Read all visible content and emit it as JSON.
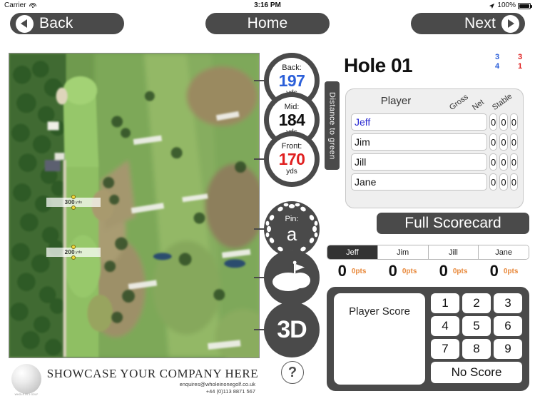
{
  "status_bar": {
    "carrier": "Carrier",
    "wifi_icon": "wifi-icon",
    "time": "3:16 PM",
    "location_icon": "location-arrow-icon",
    "battery_percent": "100%",
    "battery_icon": "battery-full-icon"
  },
  "nav": {
    "back_label": "Back",
    "back_icon": "chevron-left-circle-icon",
    "home_label": "Home",
    "next_label": "Next",
    "next_icon": "chevron-right-circle-icon"
  },
  "map": {
    "name": "aerial-hole-view",
    "markers": [
      {
        "label": "300",
        "unit": "yds"
      },
      {
        "label": "200",
        "unit": "yds"
      }
    ]
  },
  "distance": {
    "panel_label": "Distance to green",
    "readings": [
      {
        "name": "back",
        "label": "Back:",
        "value": "197",
        "unit": "yds",
        "color": "#2b5fd9"
      },
      {
        "name": "mid",
        "label": "Mid:",
        "value": "184",
        "unit": "yds",
        "color": "#111111"
      },
      {
        "name": "front",
        "label": "Front:",
        "value": "170",
        "unit": "yds",
        "color": "#e02020"
      }
    ]
  },
  "tools": {
    "pin_label": "Pin:",
    "pin_value": "a",
    "green_icon": "green-flag-icon",
    "three_d_label": "3D",
    "help_label": "?"
  },
  "advert": {
    "logo_icon": "golf-ball-icon",
    "logo_caption": "WHOLE IN 1 GOLF",
    "headline": "SHOWCASE YOUR COMPANY HERE",
    "email": "enquires@wholeinonegolf.co.uk",
    "phone": "+44 (0)113 8871 567"
  },
  "hole": {
    "title": "Hole 01",
    "stats": [
      {
        "value": "3",
        "color": "#2b5fd9"
      },
      {
        "value": "3",
        "color": "#e02020"
      },
      {
        "value": "4",
        "color": "#2b5fd9"
      },
      {
        "value": "1",
        "color": "#e02020"
      }
    ]
  },
  "scorecard": {
    "player_header": "Player",
    "columns": [
      "Gross",
      "Net",
      "Stable"
    ],
    "rows": [
      {
        "player": "Jeff",
        "gross": "0",
        "net": "0",
        "stable": "0",
        "selected": true
      },
      {
        "player": "Jim",
        "gross": "0",
        "net": "0",
        "stable": "0",
        "selected": false
      },
      {
        "player": "Jill",
        "gross": "0",
        "net": "0",
        "stable": "0",
        "selected": false
      },
      {
        "player": "Jane",
        "gross": "0",
        "net": "0",
        "stable": "0",
        "selected": false
      }
    ],
    "full_scorecard_label": "Full Scorecard"
  },
  "player_tabs": {
    "active": "Jeff",
    "items": [
      {
        "label": "Jeff",
        "score": "0",
        "points": "0pts"
      },
      {
        "label": "Jim",
        "score": "0",
        "points": "0pts"
      },
      {
        "label": "Jill",
        "score": "0",
        "points": "0pts"
      },
      {
        "label": "Jane",
        "score": "0",
        "points": "0pts"
      }
    ]
  },
  "keypad": {
    "display_label": "Player Score",
    "keys": [
      "1",
      "2",
      "3",
      "4",
      "5",
      "6",
      "7",
      "8",
      "9"
    ],
    "no_score_label": "No Score"
  },
  "colors": {
    "dark": "#4a4a4a",
    "blue": "#2b5fd9",
    "red": "#e02020",
    "orange": "#e8883a"
  }
}
